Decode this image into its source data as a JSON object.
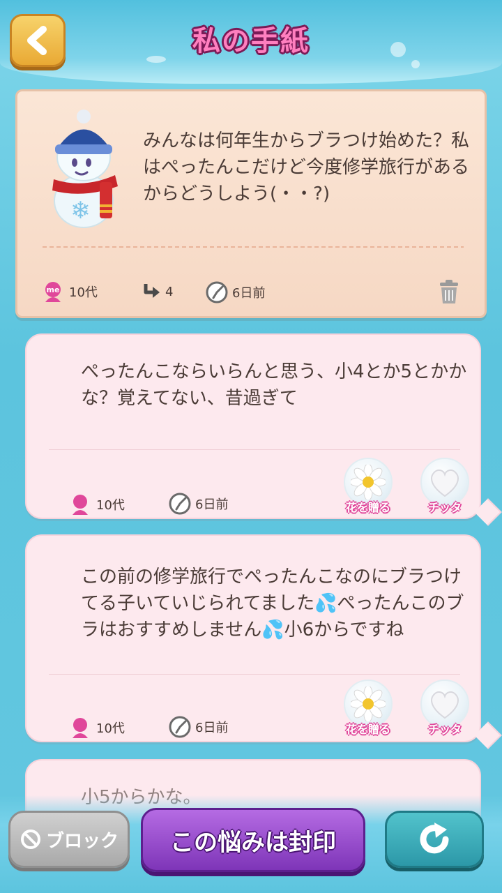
{
  "header": {
    "title": "私の手紙"
  },
  "letter": {
    "text": "みんなは何年生からブラつけ始めた？私はぺったんこだけど今度修学旅行があるからどうしよう(・・?)",
    "age": "10代",
    "reply_count": "4",
    "time": "6日前"
  },
  "replies": [
    {
      "text": "ぺったんこならいらんと思う、小4とか5とかかな？覚えてない、昔過ぎて",
      "age": "10代",
      "time": "6日前",
      "flower_label": "花を贈る",
      "heart_label": "チッタ"
    },
    {
      "text": "この前の修学旅行でぺったんこなのにブラつけてる子いていじられてました💦ぺったんこのブラはおすすめしません💦小6からですね",
      "age": "10代",
      "time": "6日前",
      "flower_label": "花を贈る",
      "heart_label": "チッタ"
    },
    {
      "text": "小5からかな。"
    }
  ],
  "bottom": {
    "block_label": "ブロック",
    "seal_label": "この悩みは封印"
  },
  "icons": {
    "back": "back-arrow-icon",
    "me_badge": "me-badge-icon",
    "reply": "reply-arrow-icon",
    "clock": "clock-icon",
    "trash": "trash-icon",
    "person": "person-icon",
    "flower": "daisy-flower-icon",
    "heart": "heart-icon",
    "block": "block-icon",
    "refresh": "refresh-icon"
  },
  "colors": {
    "title_pink": "#ff7fbf",
    "card_pink": "#fde9ee",
    "letter_paper": "#fbe6d6",
    "seal_purple": "#7e35b8",
    "next_teal": "#2c98a8"
  }
}
